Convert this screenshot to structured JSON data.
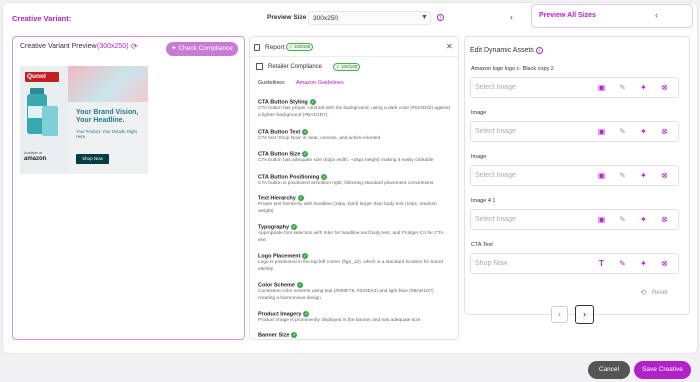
{
  "header": {
    "variant_title": "Creative Variant:",
    "preview_size_label": "Preview Size",
    "preview_size_value": "300x250",
    "preview_all_label": "Preview All Sizes"
  },
  "variant": {
    "preview_label": "Creative Variant Preview",
    "preview_size": "(300x250)",
    "check_compliance_label": "Check Compliance"
  },
  "ad": {
    "logo": "Qunol",
    "headline": "Your Brand Vision, Your Headline.",
    "body": "Your Product, Your Details, Right Here.",
    "cta": "Shop Now",
    "available_at": "Available at",
    "retailer": "amazon"
  },
  "report": {
    "title": "Report",
    "score_badge": "100/100",
    "retailer_label": "Retailer Compliance",
    "retailer_badge": "100/100",
    "guidelines_label": "Guidelines:",
    "guidelines_link": "Amazon Guidelines",
    "checks": [
      {
        "title": "CTA Button Styling",
        "desc": "CTA button has proper contrast with the background, using a dark color (#023D42) against a lighter background (#BAD1D7)."
      },
      {
        "title": "CTA Button Text",
        "desc": "CTA text 'Shop Now' is clear, concise, and action-oriented"
      },
      {
        "title": "CTA Button Size",
        "desc": "CTA button has adequate size (82px width, ~25px height) making it easily clickable"
      },
      {
        "title": "CTA Button Positioning",
        "desc": "CTA button is positioned at bottom right, following standard placement conventions"
      },
      {
        "title": "Text Hierarchy",
        "desc": "Proper text hierarchy with headline (16px, bold) larger than body text (10px, medium weight)"
      },
      {
        "title": "Typography",
        "desc": "Appropriate font selection with Inter for headline and body text, and Frutiger-Cn for CTA text"
      },
      {
        "title": "Logo Placement",
        "desc": "Logo is positioned in the top left corner (fig2_12), which is a standard location for brand identity"
      },
      {
        "title": "Color Scheme",
        "desc": "Consistent color scheme using teal (#006F78, #023D42) and light blue (#BAD1D7) creating a harmonious design"
      },
      {
        "title": "Product Imagery",
        "desc": "Product image is prominently displayed in the banner and has adequate size"
      },
      {
        "title": "Banner Size",
        "desc": ""
      }
    ]
  },
  "assets": {
    "title": "Edit Dynamic Assets",
    "items": [
      {
        "label": "Amazon logo logo c- Black copy 2",
        "placeholder": "Select Image",
        "first_icon": "image-icon"
      },
      {
        "label": "Image",
        "placeholder": "Select Image",
        "first_icon": "image-icon"
      },
      {
        "label": "Image",
        "placeholder": "Select Image",
        "first_icon": "image-icon"
      },
      {
        "label": "Image 4 1",
        "placeholder": "Select Image",
        "first_icon": "image-icon"
      },
      {
        "label": "CTA Text",
        "placeholder": "Shop Now",
        "first_icon": "text-icon"
      }
    ],
    "reset_label": "Reset"
  },
  "footer": {
    "cancel_label": "Cancel",
    "save_label": "Save Creative"
  },
  "colors": {
    "accent": "#b121c9",
    "success": "#3aa845",
    "cta_dark": "#023d42"
  }
}
